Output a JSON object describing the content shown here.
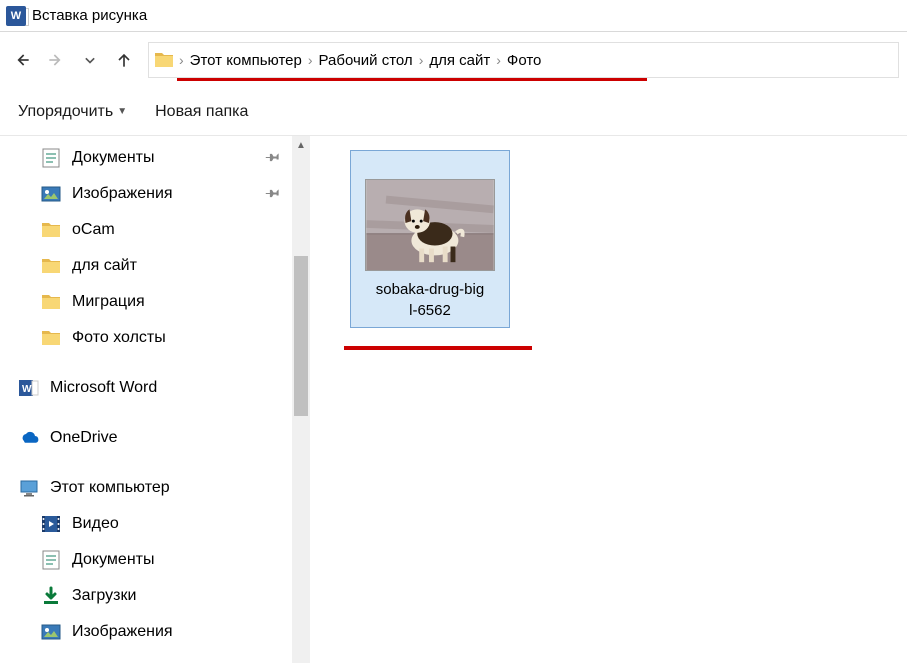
{
  "titlebar": {
    "title": "Вставка рисунка"
  },
  "breadcrumb": {
    "items": [
      "Этот компьютер",
      "Рабочий стол",
      "для сайт",
      "Фото"
    ]
  },
  "toolbar": {
    "organize": "Упорядочить",
    "newfolder": "Новая папка"
  },
  "sidebar": {
    "items": [
      {
        "label": "Документы",
        "icon": "doc",
        "pinned": true,
        "level": 1
      },
      {
        "label": "Изображения",
        "icon": "img",
        "pinned": true,
        "level": 1
      },
      {
        "label": "oCam",
        "icon": "folder",
        "level": 1
      },
      {
        "label": "для сайт",
        "icon": "folder",
        "level": 1
      },
      {
        "label": "Миграция",
        "icon": "folder",
        "level": 1
      },
      {
        "label": "Фото холсты",
        "icon": "folder",
        "level": 1
      },
      {
        "label": "Microsoft Word",
        "icon": "word",
        "level": 0,
        "gapTop": true
      },
      {
        "label": "OneDrive",
        "icon": "onedrive",
        "level": 0,
        "gapTop": true
      },
      {
        "label": "Этот компьютер",
        "icon": "pc",
        "level": 0,
        "gapTop": true
      },
      {
        "label": "Видео",
        "icon": "video",
        "level": 1
      },
      {
        "label": "Документы",
        "icon": "doc",
        "level": 1
      },
      {
        "label": "Загрузки",
        "icon": "download",
        "level": 1
      },
      {
        "label": "Изображения",
        "icon": "img",
        "level": 1
      }
    ]
  },
  "file": {
    "name_line1": "sobaka-drug-big",
    "name_line2": "l-6562"
  }
}
